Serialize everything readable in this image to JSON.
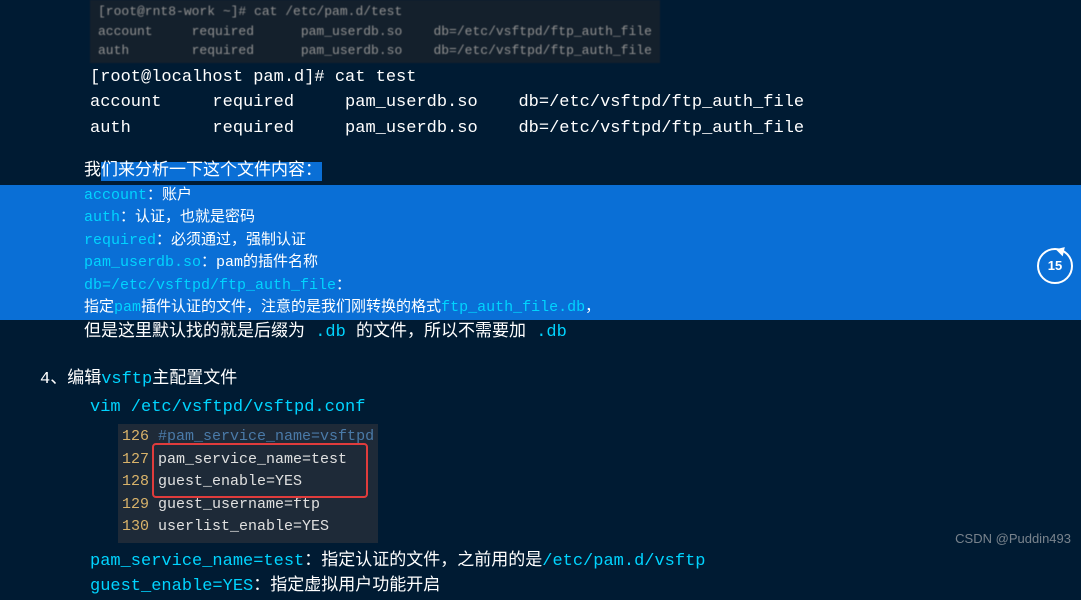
{
  "dim": {
    "prompt": "[root@rnt8-work ~]# cat /etc/pam.d/test",
    "row1": "account     required      pam_userdb.so    db=/etc/vsftpd/ftp_auth_file",
    "row2": "auth        required      pam_userdb.so    db=/etc/vsftpd/ftp_auth_file"
  },
  "main": {
    "prompt": "[root@localhost pam.d]# cat test",
    "row1": "account     required     pam_userdb.so    db=/etc/vsftpd/ftp_auth_file",
    "row2": "auth        required     pam_userdb.so    db=/etc/vsftpd/ftp_auth_file"
  },
  "analysis": {
    "intro_a": "我",
    "intro_b": "们来分析一下这个文件内容：",
    "account": {
      "k": "account",
      "v": "：账户"
    },
    "auth": {
      "k": "auth",
      "v": "：认证，也就是密码"
    },
    "required": {
      "k": "required",
      "v": "：必须通过，强制认证"
    },
    "pam_userdb": {
      "k": "pam_userdb.so",
      "v": "：pam的插件名称"
    },
    "db": {
      "k": "db=/etc/vsftpd/ftp_auth_file",
      "v": "："
    },
    "note1a": "指定",
    "note1b": "pam",
    "note1c": "插件认证",
    "note1d": "的文件，注意的是我们刚转换的格式",
    "note1e": "ftp_auth_file.db",
    "note1f": "，",
    "note2a": "但是这里默认找的就是后缀为 ",
    "note2b": ".db",
    "note2c": " 的文件，所以不需要加  ",
    "note2d": ".db"
  },
  "section4": {
    "title_a": "4、编辑",
    "title_b": "vsftp",
    "title_c": "主配置文件",
    "vim": "vim /etc/vsftpd/vsftpd.conf"
  },
  "code": {
    "l126": {
      "n": "126",
      "t": "#pam_service_name=vsftpd"
    },
    "l127": {
      "n": "127",
      "t": "pam_service_name=test"
    },
    "l128": {
      "n": "128",
      "t": "guest_enable=YES"
    },
    "l129": {
      "n": "129",
      "t": "guest_username=ftp"
    },
    "l130": {
      "n": "130",
      "t": "userlist_enable=YES"
    }
  },
  "bottom": {
    "l1": {
      "k": "pam_service_name=test",
      "v": "：指定认证的文件，之前用的是",
      "p": "/etc/pam.d/vsftp"
    },
    "l2": {
      "k": "guest_enable=YES",
      "v": "：指定虚拟用户功能开启"
    }
  },
  "watermark": "CSDN @Puddin493",
  "skip_icon": "15"
}
